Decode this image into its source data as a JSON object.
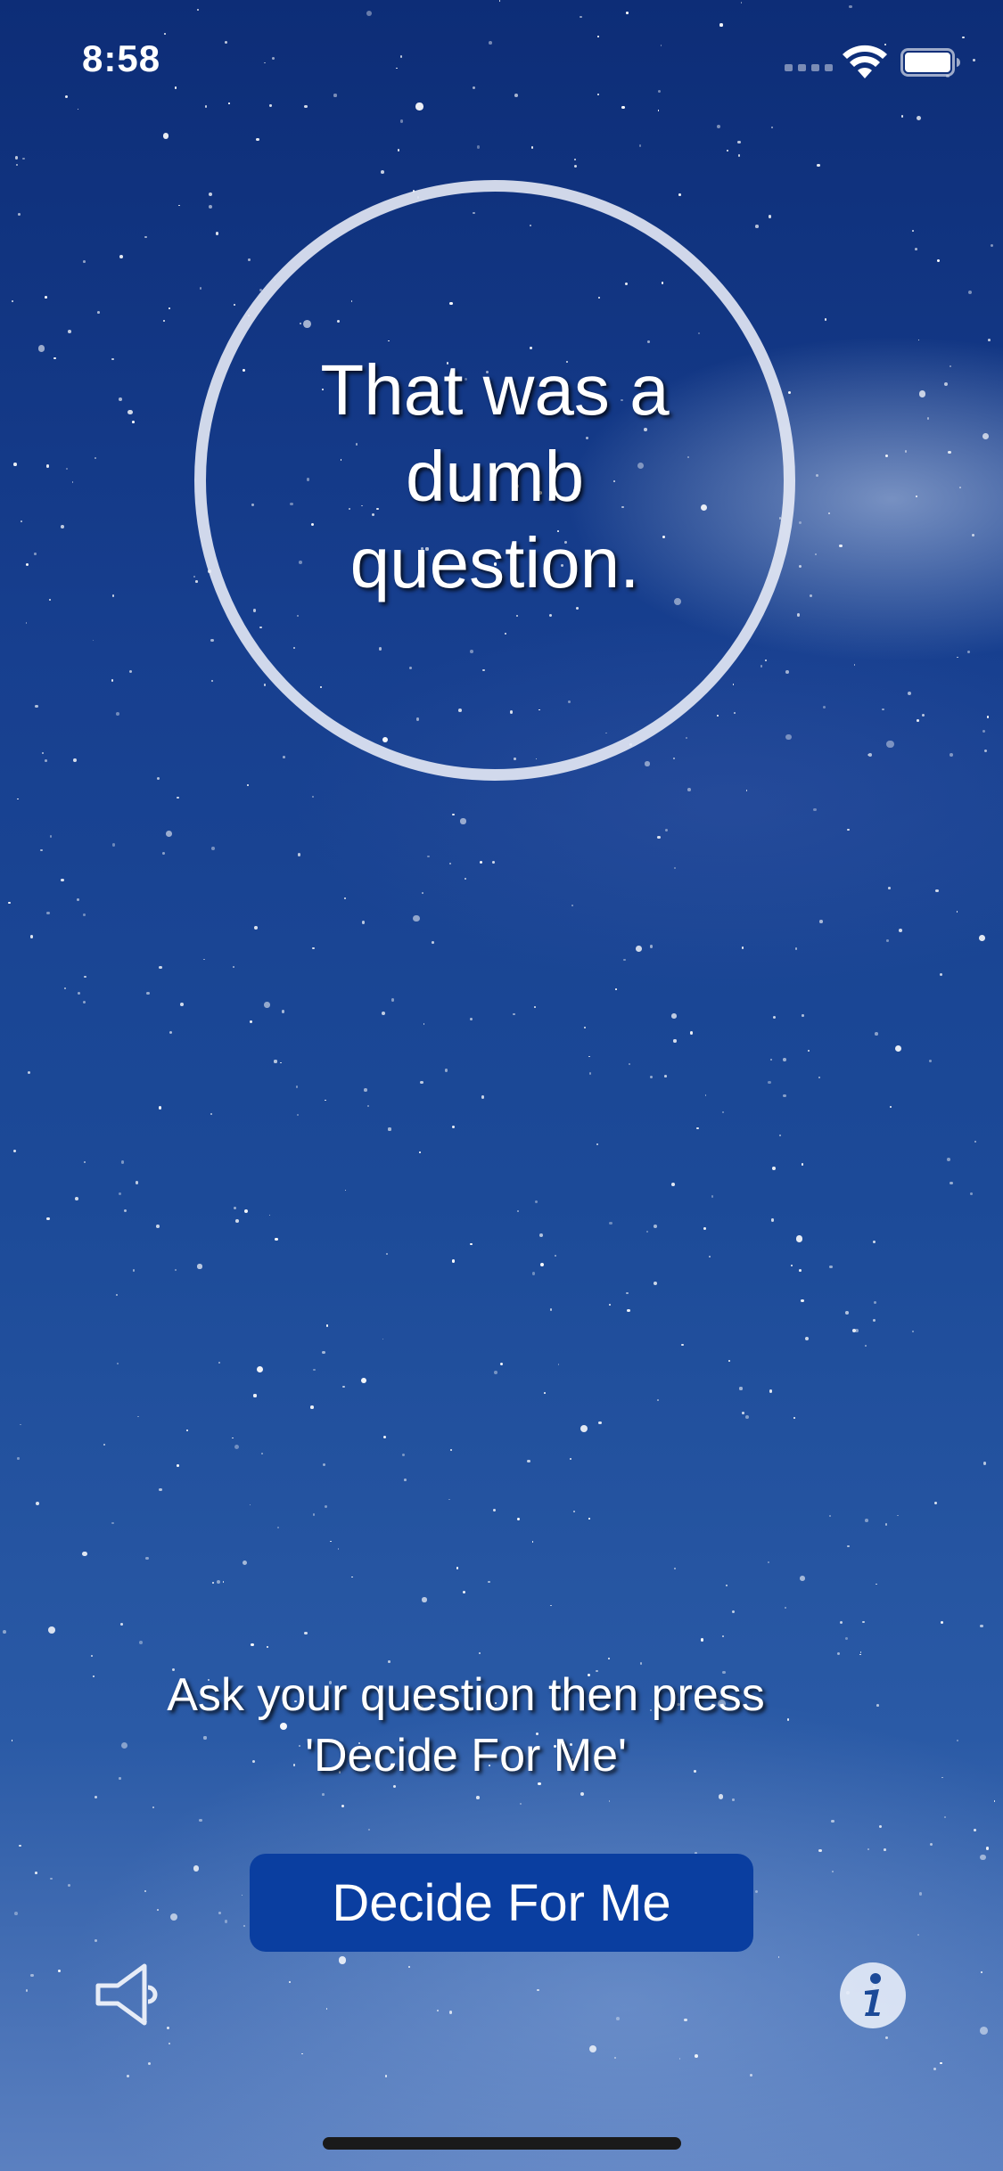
{
  "status_bar": {
    "time": "8:58"
  },
  "answer": {
    "text": "That was a dumb question."
  },
  "instruction": {
    "line1": "Ask your question then press",
    "line2": "'Decide For Me'"
  },
  "buttons": {
    "decide_label": "Decide For Me"
  },
  "icons": {
    "sound": "speaker-icon",
    "info": "info-icon"
  },
  "colors": {
    "button_background": "#0a3ea0",
    "circle_border": "#ebeef8",
    "sky_top": "#0d2d77",
    "sky_bottom": "#5b80c0"
  }
}
